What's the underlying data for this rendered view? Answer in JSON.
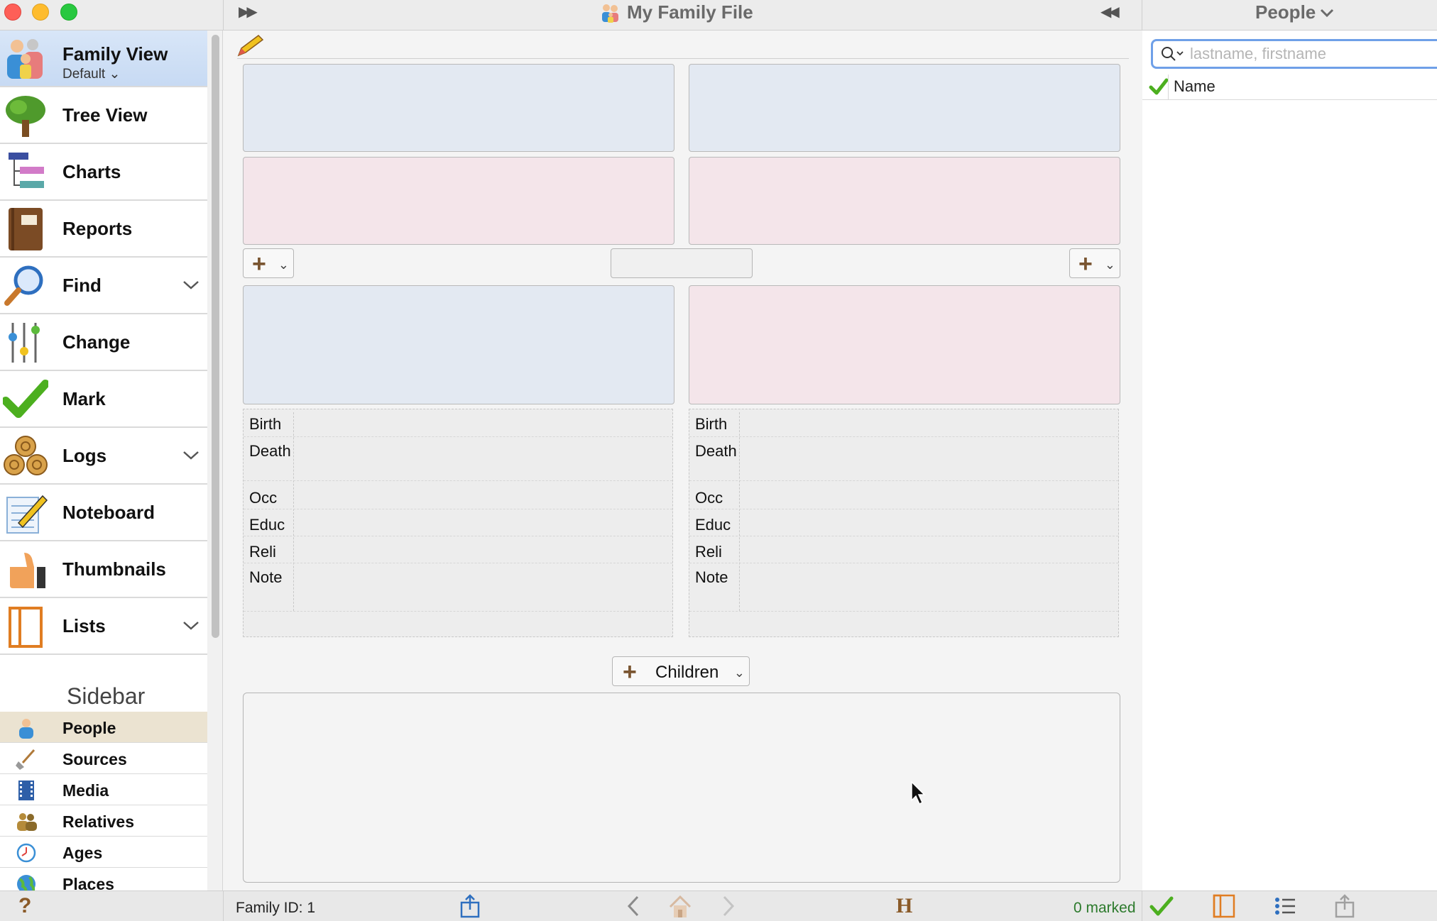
{
  "window": {
    "title": "My Family File"
  },
  "right_header": {
    "title": "People"
  },
  "nav": {
    "items": [
      {
        "label": "Family View",
        "sub": "Default"
      },
      {
        "label": "Tree View"
      },
      {
        "label": "Charts"
      },
      {
        "label": "Reports"
      },
      {
        "label": "Find"
      },
      {
        "label": "Change"
      },
      {
        "label": "Mark"
      },
      {
        "label": "Logs"
      },
      {
        "label": "Noteboard"
      },
      {
        "label": "Thumbnails"
      },
      {
        "label": "Lists"
      }
    ]
  },
  "sidebar": {
    "heading": "Sidebar",
    "items": [
      {
        "label": "People"
      },
      {
        "label": "Sources"
      },
      {
        "label": "Media"
      },
      {
        "label": "Relatives"
      },
      {
        "label": "Ages"
      },
      {
        "label": "Places"
      }
    ]
  },
  "details": {
    "labels": [
      "Birth",
      "Death",
      "Occ",
      "Educ",
      "Reli",
      "Note"
    ]
  },
  "children": {
    "label": "Children"
  },
  "search": {
    "placeholder": "lastname, firstname",
    "value": ""
  },
  "list": {
    "column": "Name"
  },
  "status": {
    "family_id": "Family ID: 1",
    "marked": "0 marked",
    "help": "?",
    "history": "H"
  },
  "colors": {
    "accent": "#6fa0e8",
    "male": "#e3e9f2",
    "female": "#f4e5ea",
    "selected": "#c7daf3"
  }
}
